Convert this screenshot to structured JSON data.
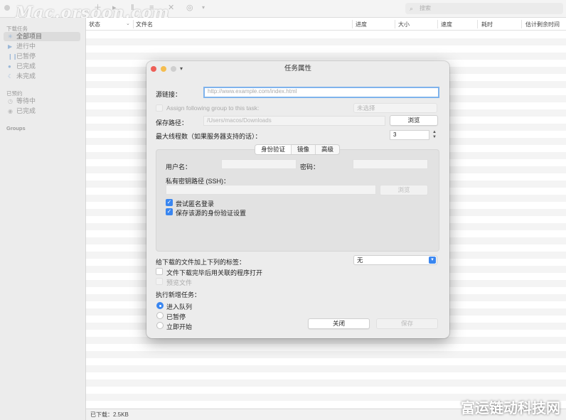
{
  "watermark": "Mac.orsoon.com",
  "corner_watermark": "富运链动科技网",
  "toolbar": {
    "search_placeholder": "搜索"
  },
  "sidebar": {
    "section_downloads": "下载任务",
    "items": [
      {
        "label": "全部项目",
        "icon": "asterisk-icon"
      },
      {
        "label": "进行中",
        "icon": "play-icon"
      },
      {
        "label": "已暂停",
        "icon": "pause-icon"
      },
      {
        "label": "已完成",
        "icon": "dot-icon"
      },
      {
        "label": "未完成",
        "icon": "moon-icon"
      }
    ],
    "section_scheduled": "已预约",
    "scheduled_items": [
      {
        "label": "等待中",
        "icon": "clock-icon"
      },
      {
        "label": "已完成",
        "icon": "check-circle-icon"
      }
    ],
    "section_groups": "Groups"
  },
  "table": {
    "columns": [
      "状态",
      "文件名",
      "进度",
      "大小",
      "速度",
      "耗时",
      "估计剩余时间"
    ]
  },
  "statusbar": {
    "downloaded": "已下载：2.5KB"
  },
  "dialog": {
    "title": "任务属性",
    "source_label": "源链接：",
    "source_placeholder": "http://www.example.com/index.html",
    "assign_group_label": "Assign following group to this task:",
    "assign_group_select": "未选择",
    "save_path_label": "保存路径：",
    "save_path_value": "/Users/macos/Downloads",
    "browse": "浏览",
    "max_threads_label": "最大线程数（如果服务器支持的话）：",
    "max_threads_value": "3",
    "tabs": [
      "身份验证",
      "镜像",
      "高级"
    ],
    "username_label": "用户名：",
    "password_label": "密码：",
    "ssh_key_label": "私有密钥路径 (SSH)：",
    "ssh_browse": "浏览",
    "try_anonymous": "尝试匿名登录",
    "save_auth": "保存该源的身份验证设置",
    "tags_label": "给下载的文件加上下列的标签：",
    "tags_value": "无",
    "open_after": "文件下载完毕后用关联的程序打开",
    "preview_file": "预览文件",
    "run_label": "执行新增任务：",
    "run_options": [
      "进入队列",
      "已暂停",
      "立即开始"
    ],
    "close_button": "关闭",
    "save_button": "保存"
  },
  "colors": {
    "accent": "#3a86f0",
    "close": "#ee5f57",
    "minimize": "#f5bd4f"
  }
}
